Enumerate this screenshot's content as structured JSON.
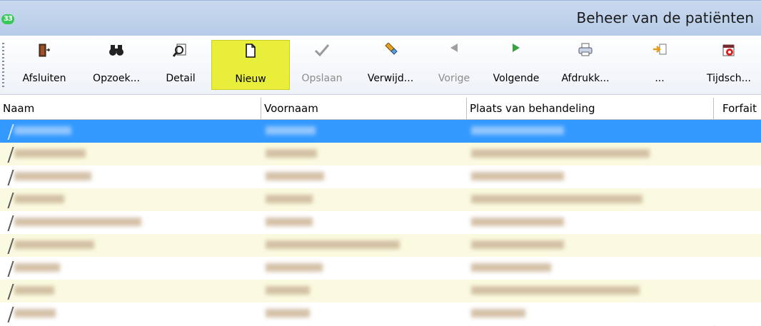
{
  "window": {
    "title": "Beheer van de patiënten",
    "app_icon_text": "33"
  },
  "toolbar": {
    "buttons": [
      {
        "label": "Afsluiten",
        "icon": "exit-door-icon",
        "enabled": true
      },
      {
        "label": "Opzoek...",
        "icon": "binoculars-icon",
        "enabled": true
      },
      {
        "label": "Detail",
        "icon": "magnify-document-icon",
        "enabled": true
      },
      {
        "label": "Nieuw",
        "icon": "new-document-icon",
        "enabled": true,
        "active": true
      },
      {
        "label": "Opslaan",
        "icon": "checkmark-icon",
        "enabled": false
      },
      {
        "label": "Verwijd...",
        "icon": "eraser-icon",
        "enabled": true
      },
      {
        "label": "Vorige",
        "icon": "arrow-left-icon",
        "enabled": false
      },
      {
        "label": "Volgende",
        "icon": "arrow-right-icon",
        "enabled": true
      },
      {
        "label": "Afdrukk...",
        "icon": "printer-icon",
        "enabled": true
      },
      {
        "label": "...",
        "icon": "export-icon",
        "enabled": true
      },
      {
        "label": "Tijdsch...",
        "icon": "calendar-icon",
        "enabled": true
      }
    ],
    "active_color": "#e8ee3a"
  },
  "grid": {
    "columns": [
      "Naam",
      "Voornaam",
      "Plaats van behandeling",
      "Forfait"
    ],
    "selected_color": "#3399ff",
    "row_alt_color": "#fafae0"
  }
}
